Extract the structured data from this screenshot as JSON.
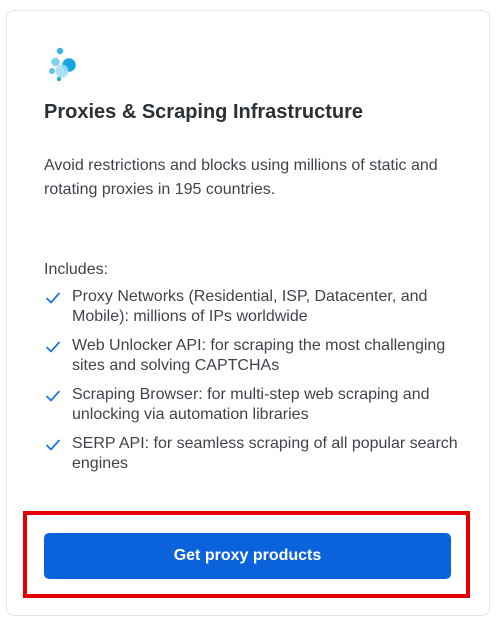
{
  "card": {
    "logo_icon": "proxy-network-logo-icon",
    "title": "Proxies & Scraping Infrastructure",
    "description": "Avoid restrictions and blocks using millions of static and rotating proxies in 195 countries.",
    "includes_label": "Includes:",
    "features": [
      {
        "text": "Proxy Networks (Residential, ISP, Datacenter, and Mobile): millions of IPs worldwide",
        "icon": "check-icon"
      },
      {
        "text": "Web Unlocker API: for scraping the most challenging sites and solving CAPTCHAs",
        "icon": "check-icon"
      },
      {
        "text": "Scraping Browser: for multi-step web scraping and unlocking via automation libraries",
        "icon": "check-icon"
      },
      {
        "text": "SERP API: for seamless scraping of all popular search engines",
        "icon": "check-icon"
      }
    ],
    "cta_label": "Get proxy products"
  },
  "colors": {
    "accent": "#0b63dc",
    "check": "#1a73e8",
    "highlight_border": "#e30000",
    "title_text": "#2b2f36",
    "body_text": "#3f444c"
  }
}
